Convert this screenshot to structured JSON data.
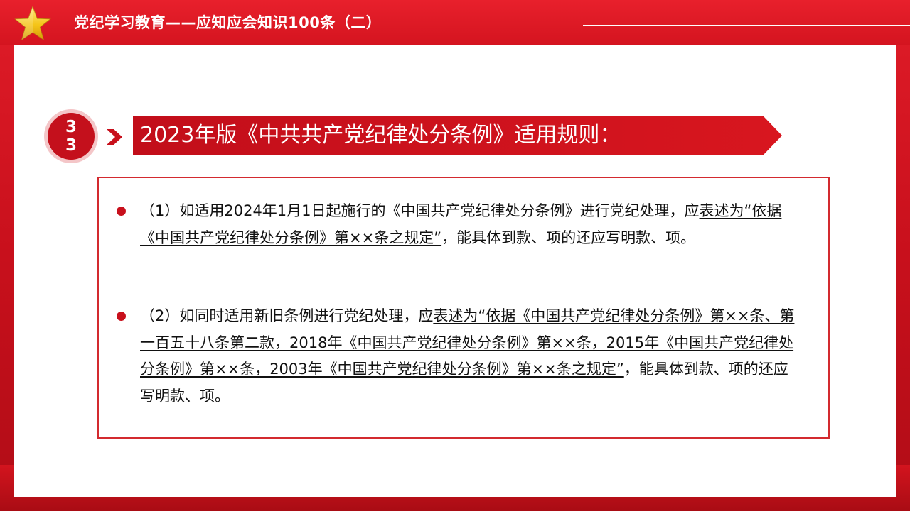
{
  "header": {
    "title": "党纪学习教育——应知应会知识100条（二）"
  },
  "section": {
    "number": "33",
    "title": "2023年版《中共共产党纪律处分条例》适用规则："
  },
  "rules": [
    {
      "pre": "（1）如适用2024年1月1日起施行的《中国共产党纪律处分条例》进行党纪处理，应",
      "underlined": "表述为“依据《中国共产党纪律处分条例》第××条之规定”",
      "post": "，能具体到款、项的还应写明款、项。"
    },
    {
      "pre": "（2）如同时适用新旧条例进行党纪处理，应",
      "underlined": "表述为“依据《中国共产党纪律处分条例》第××条、第一百五十八条第二款，2018年《中国共产党纪律处分条例》第××条，2015年《中国共产党纪律处分条例》第××条，2003年《中国共产党纪律处分条例》第××条之规定”",
      "post": "，能具体到款、项的还应写明款、项。"
    }
  ],
  "colors": {
    "primary_red": "#c8101c",
    "star_gold": "#f5c518",
    "box_border": "#d32a2f"
  },
  "icons": {
    "header_star": "star-icon",
    "title_arrow": "chevron-right-icon",
    "bullet": "bullet-dot-icon"
  }
}
